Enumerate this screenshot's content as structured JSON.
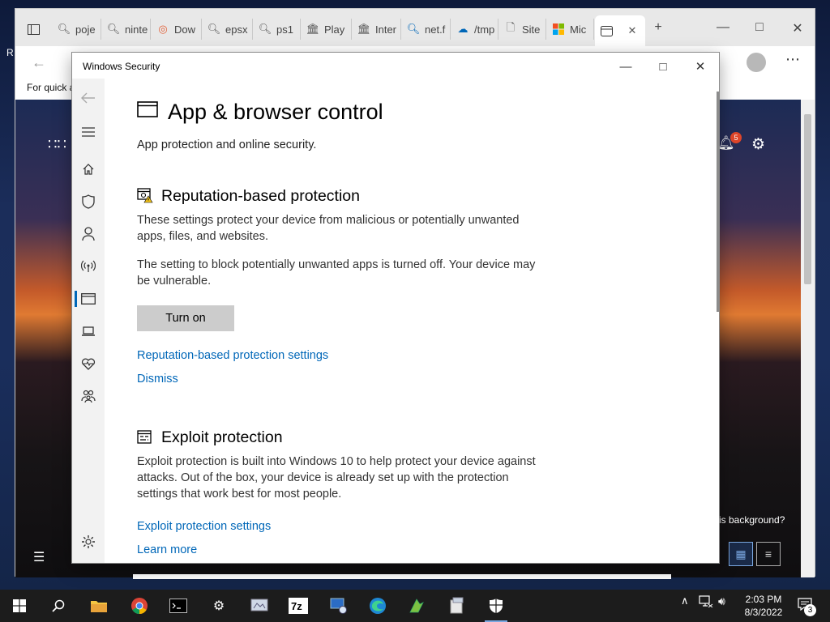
{
  "browser": {
    "tabs": [
      {
        "label": "poje",
        "icon": "search-icon"
      },
      {
        "label": "ninte",
        "icon": "search-icon"
      },
      {
        "label": "Dow",
        "icon": "download-icon"
      },
      {
        "label": "epsx",
        "icon": "search-icon"
      },
      {
        "label": "ps1",
        "icon": "search-icon"
      },
      {
        "label": "Play",
        "icon": "archive-icon"
      },
      {
        "label": "Inter",
        "icon": "archive-icon"
      },
      {
        "label": "net.f",
        "icon": "search-icon"
      },
      {
        "label": "/tmp",
        "icon": "cloud-icon"
      },
      {
        "label": "Site",
        "icon": "page-icon"
      },
      {
        "label": "Mic",
        "icon": "microsoft-icon"
      }
    ],
    "favorites_text": "For quick a",
    "page_snippet": "is background?"
  },
  "window": {
    "title": "Windows Security"
  },
  "page": {
    "title": "App & browser control",
    "subtitle": "App protection and online security."
  },
  "reputation": {
    "title": "Reputation-based protection",
    "description": "These settings protect your device from malicious or potentially unwanted apps, files, and websites.",
    "warning": "The setting to block potentially unwanted apps is turned off. Your device may be vulnerable.",
    "button_label": "Turn on",
    "settings_link": "Reputation-based protection settings",
    "dismiss_link": "Dismiss"
  },
  "exploit": {
    "title": "Exploit protection",
    "description": "Exploit protection is built into Windows 10 to help protect your device against attacks.  Out of the box, your device is already set up with the protection settings that work best for most people.",
    "settings_link": "Exploit protection settings",
    "learn_more": "Learn more"
  },
  "taskbar": {
    "time": "2:03 PM",
    "date": "8/3/2022",
    "notification_count": "3",
    "bell_badge": "5"
  },
  "colors": {
    "link": "#0067b8",
    "button": "#cccccc",
    "nav_background": "#f2f2f2"
  }
}
